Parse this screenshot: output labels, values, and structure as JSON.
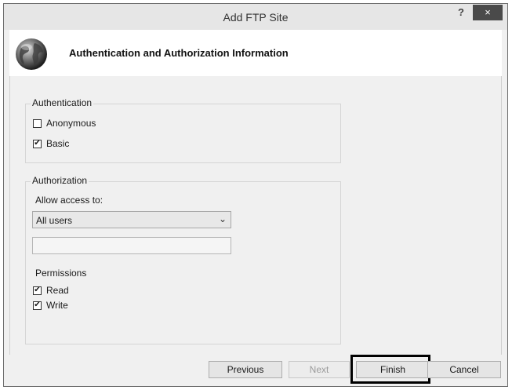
{
  "window": {
    "title": "Add FTP Site",
    "help_label": "?",
    "close_label": "×"
  },
  "header": {
    "title": "Authentication and Authorization Information",
    "icon": "globe-icon"
  },
  "authentication": {
    "legend": "Authentication",
    "options": [
      {
        "label": "Anonymous",
        "checked": false
      },
      {
        "label": "Basic",
        "checked": true
      }
    ]
  },
  "authorization": {
    "legend": "Authorization",
    "allow_access_label": "Allow access to:",
    "allow_access_value": "All users",
    "text_value": "",
    "permissions_label": "Permissions",
    "permissions": [
      {
        "label": "Read",
        "checked": true
      },
      {
        "label": "Write",
        "checked": true
      }
    ]
  },
  "footer": {
    "previous_label": "Previous",
    "next_label": "Next",
    "finish_label": "Finish",
    "cancel_label": "Cancel"
  },
  "check_glyph": "✔",
  "chevron_glyph": "⌄"
}
